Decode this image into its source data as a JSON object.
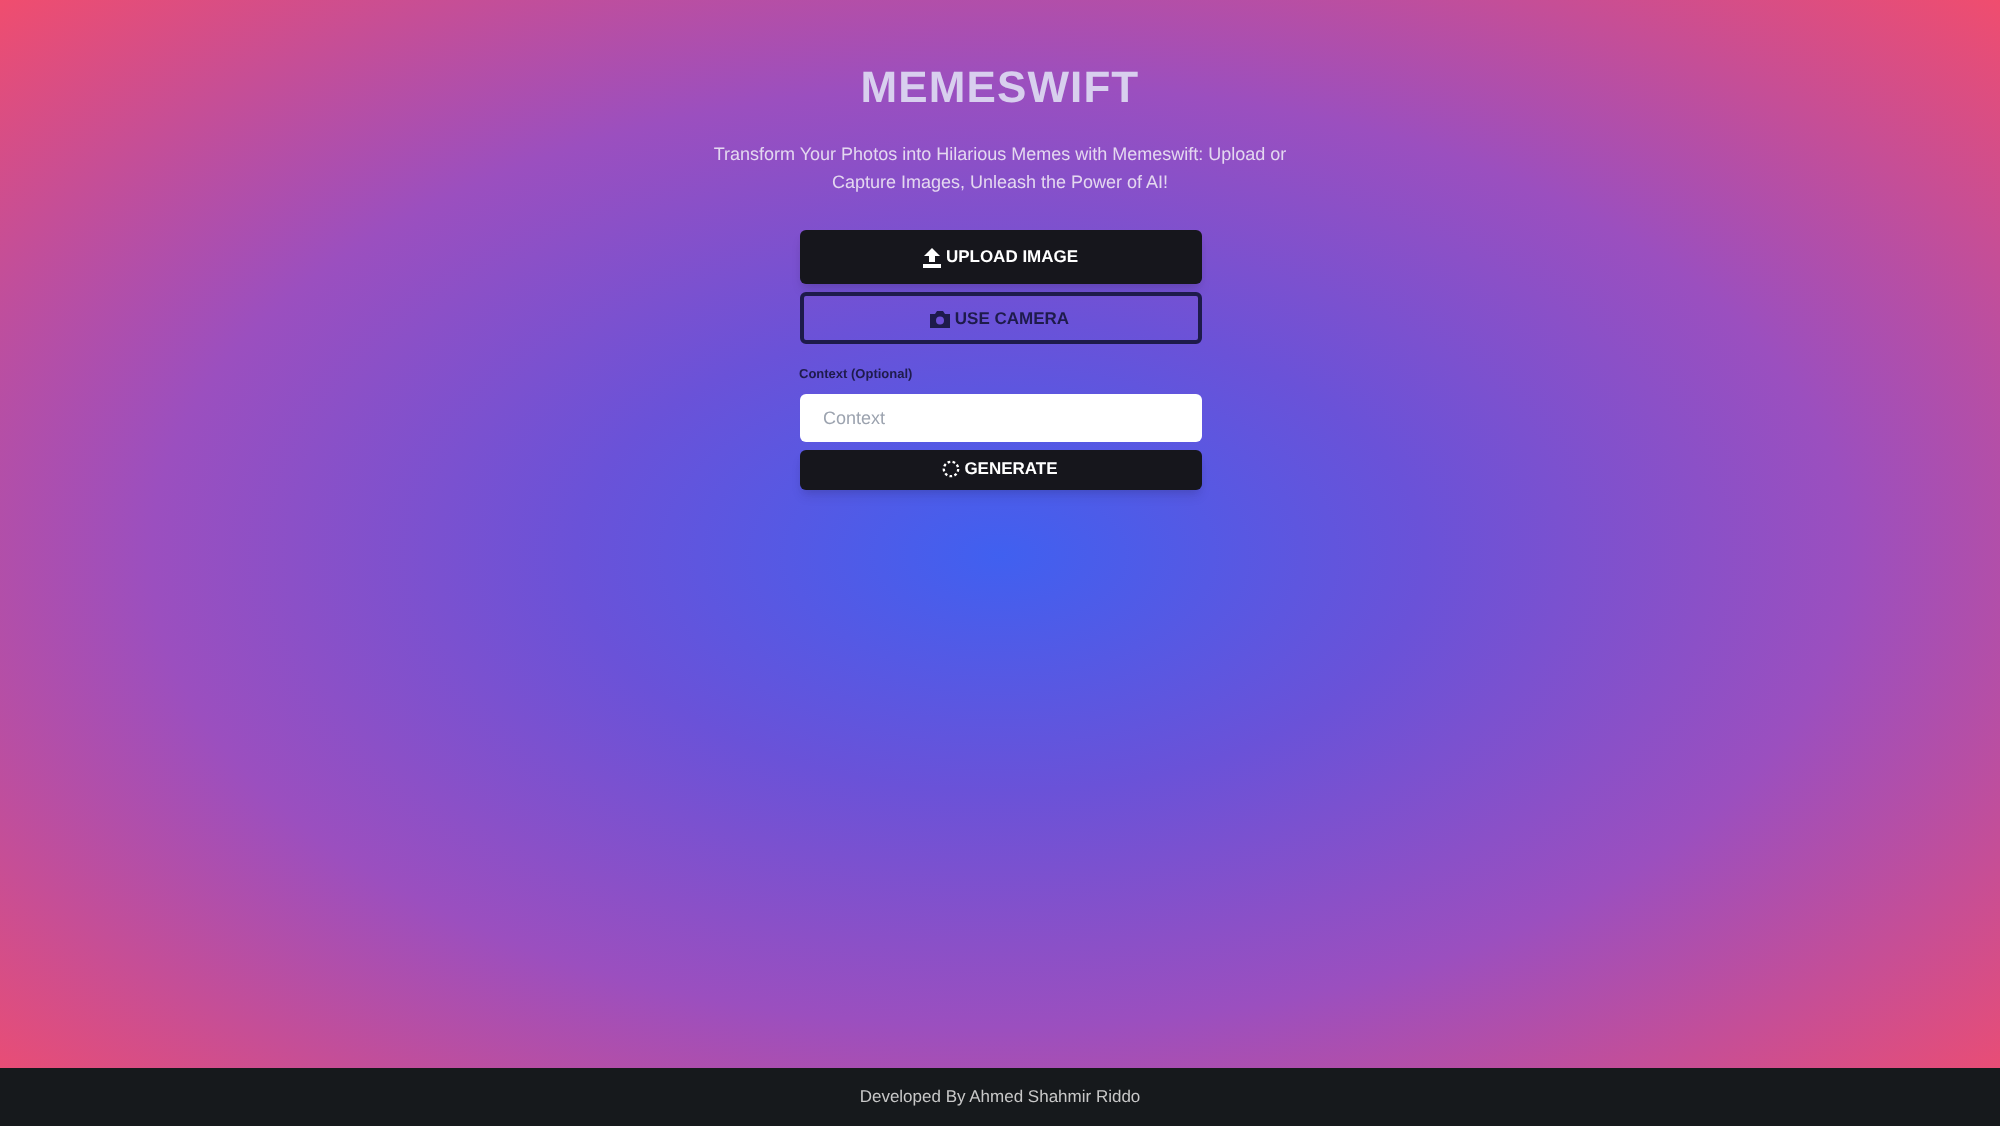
{
  "title": "MEMESWIFT",
  "subtitle": "Transform Your Photos into Hilarious Memes with Memeswift: Upload or Capture Images, Unleash the Power of AI!",
  "buttons": [
    {
      "kind": "upload",
      "label": "UPLOAD IMAGE"
    },
    {
      "kind": "camera",
      "label": "USE CAMERA"
    }
  ],
  "context_field": {
    "label": "Context (Optional)",
    "placeholder": "Context"
  },
  "generate_button": {
    "label": "GENERATE"
  },
  "footer": "Developed By Ahmed Shahmir Riddo"
}
